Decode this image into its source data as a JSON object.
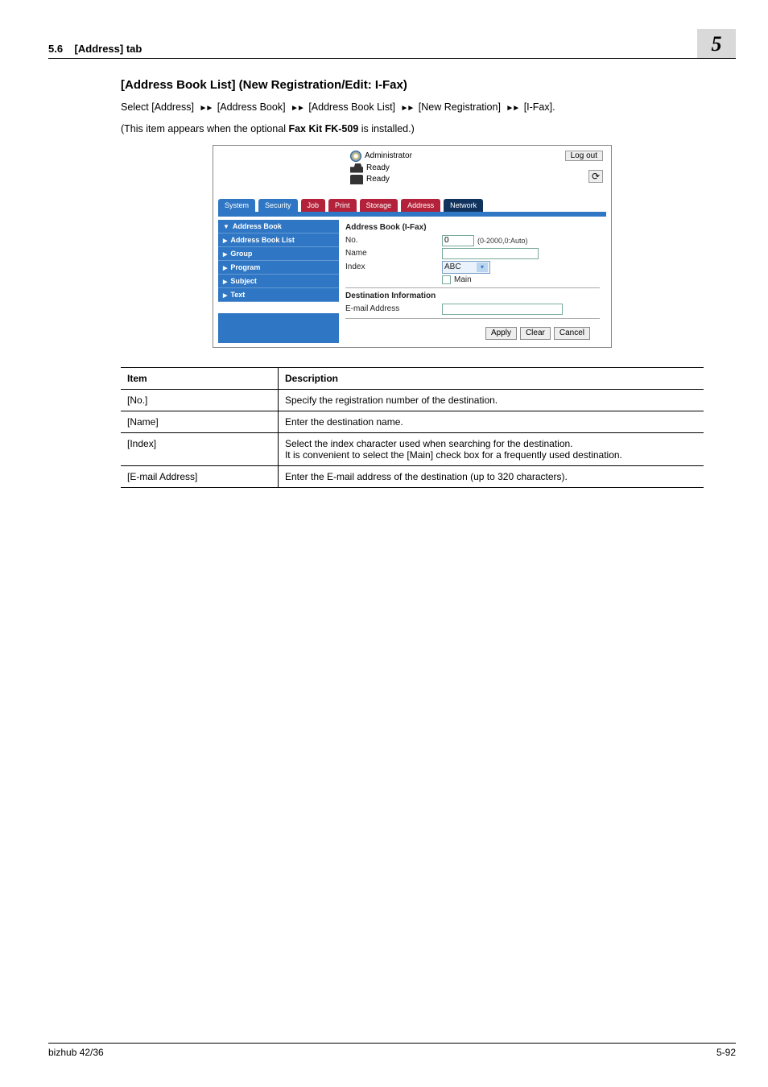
{
  "header": {
    "section_no": "5.6",
    "section_title": "[Address] tab",
    "chapter_no": "5"
  },
  "title": "[Address Book List] (New Registration/Edit: I-Fax)",
  "breadcrumb": {
    "prefix": "Select ",
    "p0": "[Address]",
    "p1": "[Address Book]",
    "p2": "[Address Book List]",
    "p3": "[New Registration]",
    "p4": "[I-Fax]."
  },
  "note_pre": "(This item appears when the optional ",
  "note_bold": "Fax Kit FK-509",
  "note_post": " is installed.)",
  "webui": {
    "admin": "Administrator",
    "logout": "Log out",
    "ready1": "Ready",
    "ready2": "Ready",
    "tabs": {
      "system": "System",
      "security": "Security",
      "job": "Job",
      "print": "Print",
      "storage": "Storage",
      "address": "Address",
      "network": "Network"
    },
    "side": {
      "s0": "Address Book",
      "s1": "Address Book List",
      "s2": "Group",
      "s3": "Program",
      "s4": "Subject",
      "s5": "Text"
    },
    "form": {
      "title": "Address Book (I-Fax)",
      "no_label": "No.",
      "no_value": "0",
      "no_hint": "(0-2000,0:Auto)",
      "name_label": "Name",
      "name_value": "",
      "index_label": "Index",
      "index_value": "ABC",
      "main_label": "Main",
      "dest_title": "Destination Information",
      "email_label": "E-mail Address",
      "email_value": ""
    },
    "buttons": {
      "apply": "Apply",
      "clear": "Clear",
      "cancel": "Cancel"
    }
  },
  "table": {
    "h_item": "Item",
    "h_desc": "Description",
    "rows": [
      {
        "item": "[No.]",
        "desc": "Specify the registration number of the destination."
      },
      {
        "item": "[Name]",
        "desc": "Enter the destination name."
      },
      {
        "item": "[Index]",
        "desc": "Select the index character used when searching for the destination.\nIt is convenient to select the [Main] check box for a frequently used destination."
      },
      {
        "item": "[E-mail Address]",
        "desc": "Enter the E-mail address of the destination (up to 320 characters)."
      }
    ]
  },
  "footer": {
    "left": "bizhub 42/36",
    "right": "5-92"
  }
}
